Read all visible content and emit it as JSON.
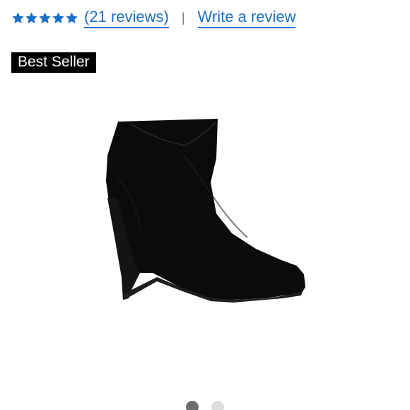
{
  "rating": {
    "value": 5,
    "max": 5,
    "star_color": "#1c6fc7",
    "reviews_link": "(21 reviews)",
    "separator": "|",
    "write_review_link": "Write a review"
  },
  "badge": {
    "label": "Best Seller",
    "background": "#000000"
  },
  "product_image": {
    "icon": "wedge-ankle-boot-image"
  },
  "carousel": {
    "total": 2,
    "active_index": 0
  }
}
